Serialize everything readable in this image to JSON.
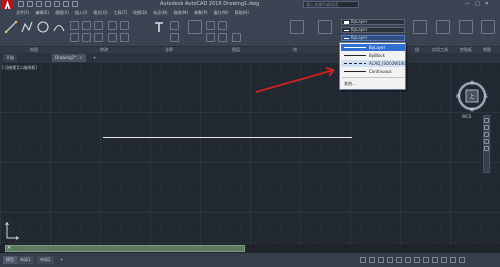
{
  "window": {
    "title": "Autodesk AutoCAD 2016    Drawing1.dwg",
    "search_placeholder": "键入关键字或短语",
    "controls": [
      "—",
      "□",
      "✕"
    ]
  },
  "menu": [
    "文件(F)",
    "编辑(E)",
    "视图(V)",
    "插入(I)",
    "格式(O)",
    "工具(T)",
    "绘图(D)",
    "标注(N)",
    "修改(M)",
    "参数(P)",
    "窗口(W)",
    "帮助(H)"
  ],
  "ribbon": {
    "panels": [
      "绘图",
      "修改",
      "注释",
      "图层",
      "块",
      "特性",
      "组",
      "实用工具",
      "剪贴板",
      "视图"
    ],
    "properties": {
      "color": "ByLayer",
      "lineweight": "ByLayer",
      "linetype": "ByLayer"
    }
  },
  "doc_tabs": [
    {
      "label": "开始"
    },
    {
      "label": "Drawing1*"
    }
  ],
  "viewport_label": "[-][俯视][二维线框]",
  "viewcube": {
    "top_label": "上",
    "north": "北",
    "south": "南",
    "east": "东",
    "west": "西",
    "wcs": "WCS"
  },
  "linetype_dropdown": {
    "items": [
      {
        "label": "ByLayer",
        "style": "solid",
        "state": "selected"
      },
      {
        "label": "ByBlock",
        "style": "solid",
        "state": "normal"
      },
      {
        "label": "ACAD_ISO02W100",
        "style": "dashed",
        "state": "hover"
      },
      {
        "label": "Continuous",
        "style": "solid",
        "state": "normal"
      }
    ],
    "other": "其他..."
  },
  "command_line": {
    "placeholder": "键入命令",
    "close": "✕"
  },
  "layout_tabs": [
    {
      "label": "模型"
    },
    {
      "label": "布局1"
    },
    {
      "label": "布局2"
    },
    {
      "label": "+"
    }
  ],
  "colors": {
    "canvas": "#212831",
    "ribbon": "#3b4251",
    "selected_item": "#2f6fd0",
    "arrow": "#d42020",
    "command_line": "#5d7a61"
  }
}
